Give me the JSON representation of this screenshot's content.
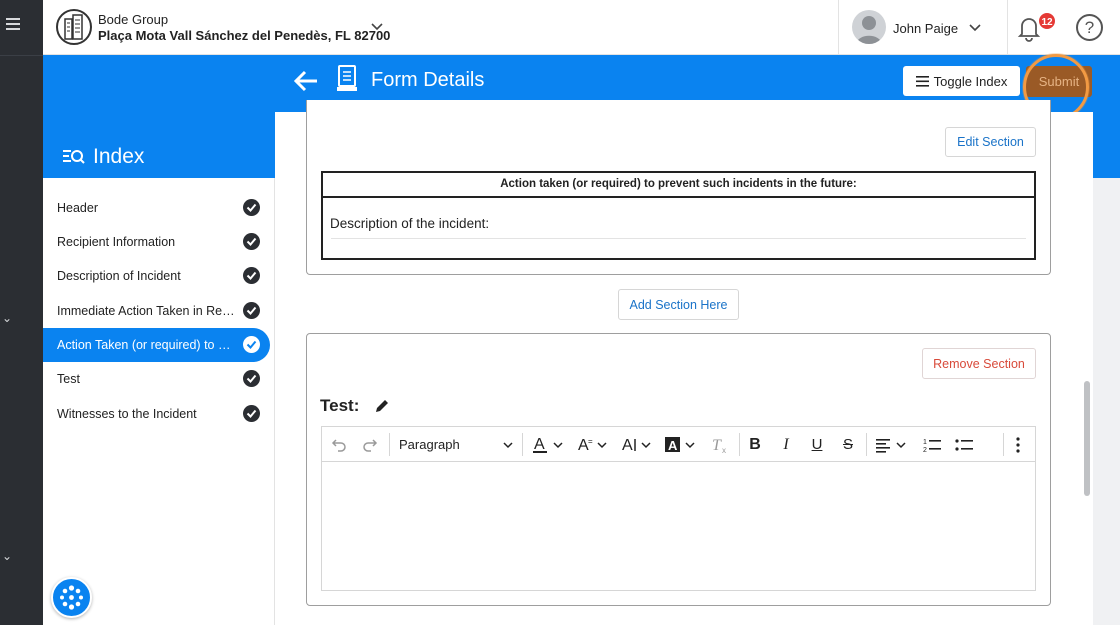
{
  "org": {
    "name": "Bode Group",
    "address": "Plaça Mota Vall Sánchez del Penedès, FL 82700"
  },
  "user": {
    "name": "John Paige"
  },
  "notifications": {
    "count": "12"
  },
  "page": {
    "title": "Form Details",
    "toggle_index_label": "Toggle Index",
    "submit_label": "Submit"
  },
  "index": {
    "title": "Index",
    "items": [
      {
        "label": "Header"
      },
      {
        "label": "Recipient Information"
      },
      {
        "label": "Description of Incident"
      },
      {
        "label": "Immediate Action Taken in Response to the Incident"
      },
      {
        "label": "Action Taken (or required) to Prevent such incidents in the future"
      },
      {
        "label": "Test"
      },
      {
        "label": "Witnesses to the Incident"
      }
    ]
  },
  "section1": {
    "edit_label": "Edit Section",
    "table_header": "Action taken (or required) to prevent such incidents in the future:",
    "table_body": "Description of the incident:"
  },
  "add_section_label": "Add Section Here",
  "section2": {
    "remove_label": "Remove Section",
    "title": "Test:",
    "paragraph_select": "Paragraph"
  },
  "colors": {
    "accent": "#0a83f0",
    "rail": "#2b2e33",
    "submit": "#9a5a26",
    "highlight_ring": "#f29a43",
    "badge": "#e53935"
  }
}
